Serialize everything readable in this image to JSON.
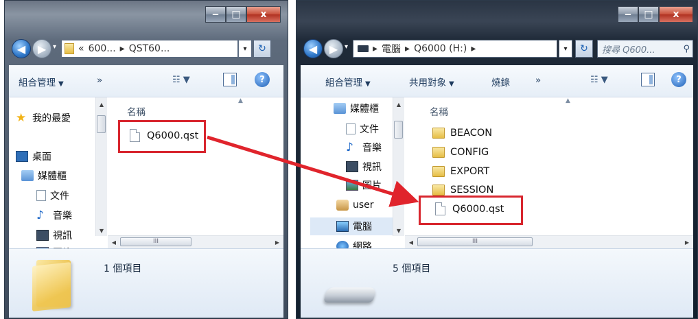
{
  "left_window": {
    "caption": {
      "minimize": "‒",
      "maximize": "□",
      "close": "x"
    },
    "address": {
      "segments": [
        "«",
        "600...",
        "▸",
        "QST60..."
      ]
    },
    "toolbar": {
      "organize": "組合管理",
      "more": "»"
    },
    "nav_pane": {
      "items": [
        "我的最愛",
        "桌面",
        "媒體櫃",
        "文件",
        "音樂",
        "視訊",
        "圖片"
      ]
    },
    "column_header": "名稱",
    "files": [
      {
        "name": "Q6000.qst",
        "type": "file"
      }
    ],
    "status": "1 個項目"
  },
  "right_window": {
    "caption": {
      "minimize": "‒",
      "maximize": "□",
      "close": "x"
    },
    "address": {
      "segments": [
        "▸",
        "電腦",
        "▸",
        "Q6000 (H:)",
        "▸"
      ]
    },
    "search_placeholder": "搜尋 Q600...",
    "toolbar": {
      "organize": "組合管理",
      "share": "共用對象",
      "burn": "燒錄",
      "more": "»"
    },
    "nav_pane": {
      "items": [
        "媒體櫃",
        "文件",
        "音樂",
        "視訊",
        "圖片",
        "user",
        "電腦",
        "網路"
      ]
    },
    "column_header": "名稱",
    "files": [
      {
        "name": "BEACON",
        "type": "folder"
      },
      {
        "name": "CONFIG",
        "type": "folder"
      },
      {
        "name": "EXPORT",
        "type": "folder"
      },
      {
        "name": "SESSION",
        "type": "folder"
      },
      {
        "name": "Q6000.qst",
        "type": "file"
      }
    ],
    "status": "5 個項目"
  },
  "scroll": {
    "h_thumb_grip": "III"
  },
  "colors": {
    "highlight": "#d8262e",
    "arrow": "#e0242c"
  }
}
